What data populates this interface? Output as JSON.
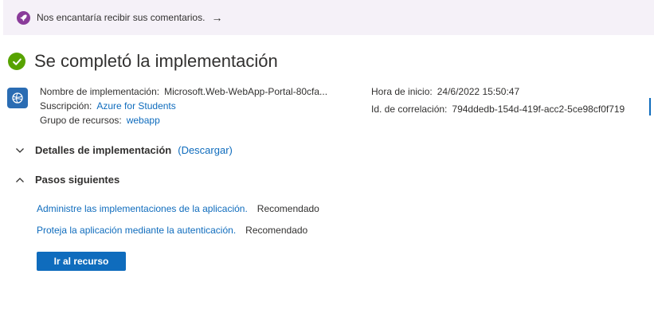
{
  "banner": {
    "icon": "rocket-icon",
    "text": "Nos encantaría recibir sus comentarios.",
    "arrow": "→"
  },
  "header": {
    "icon": "success-check-icon",
    "title": "Se completó la implementación"
  },
  "deployment": {
    "icon": "web-app-deployment-icon",
    "name_label": "Nombre de implementación:",
    "name_value": "Microsoft.Web-WebApp-Portal-80cfa...",
    "subscription_label": "Suscripción:",
    "subscription_value": "Azure for Students",
    "resource_group_label": "Grupo de recursos:",
    "resource_group_value": "webapp",
    "start_time_label": "Hora de inicio:",
    "start_time_value": "24/6/2022 15:50:47",
    "correlation_label": "Id. de correlación:",
    "correlation_value": "794ddedb-154d-419f-acc2-5ce98cf0f719"
  },
  "sections": {
    "details": {
      "title": "Detalles de implementación",
      "link": "(Descargar)",
      "state": "collapsed"
    },
    "next_steps": {
      "title": "Pasos siguientes",
      "state": "expanded",
      "items": [
        {
          "link": "Administre las implementaciones de la aplicación.",
          "tag": "Recomendado"
        },
        {
          "link": "Proteja la aplicación mediante la autenticación.",
          "tag": "Recomendado"
        }
      ]
    }
  },
  "actions": {
    "go_to_resource": "Ir al recurso"
  },
  "colors": {
    "accent": "#0f6cbd",
    "success": "#57a300",
    "banner_bg": "#f5f1f8",
    "banner_icon": "#8a3b9a"
  }
}
